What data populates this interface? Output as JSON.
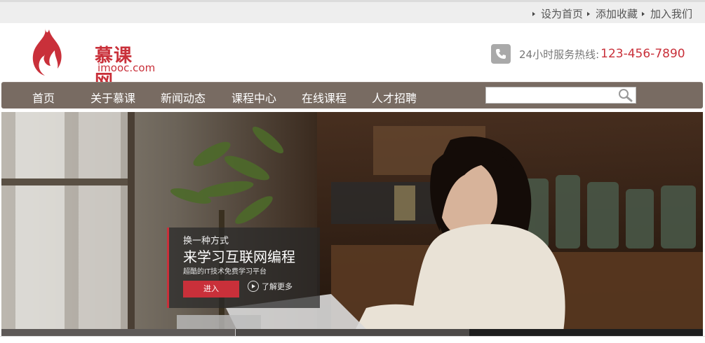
{
  "topbar": {
    "links": [
      "设为首页",
      "添加收藏",
      "加入我们"
    ]
  },
  "logo": {
    "cn": "慕课网",
    "en": "imooc.com"
  },
  "hotline": {
    "label": "24小时服务热线:",
    "number": "123-456-7890"
  },
  "nav": {
    "items": [
      "首页",
      "关于慕课",
      "新闻动态",
      "课程中心",
      "在线课程",
      "人才招聘"
    ]
  },
  "search": {
    "placeholder": ""
  },
  "banner": {
    "line1": "换一种方式",
    "line2": "来学习互联网编程",
    "line3": "超酷的IT技术免费学习平台",
    "enter_label": "进入",
    "more_label": "了解更多"
  },
  "colors": {
    "brand": "#c9303a",
    "nav_bg": "#786b62"
  }
}
